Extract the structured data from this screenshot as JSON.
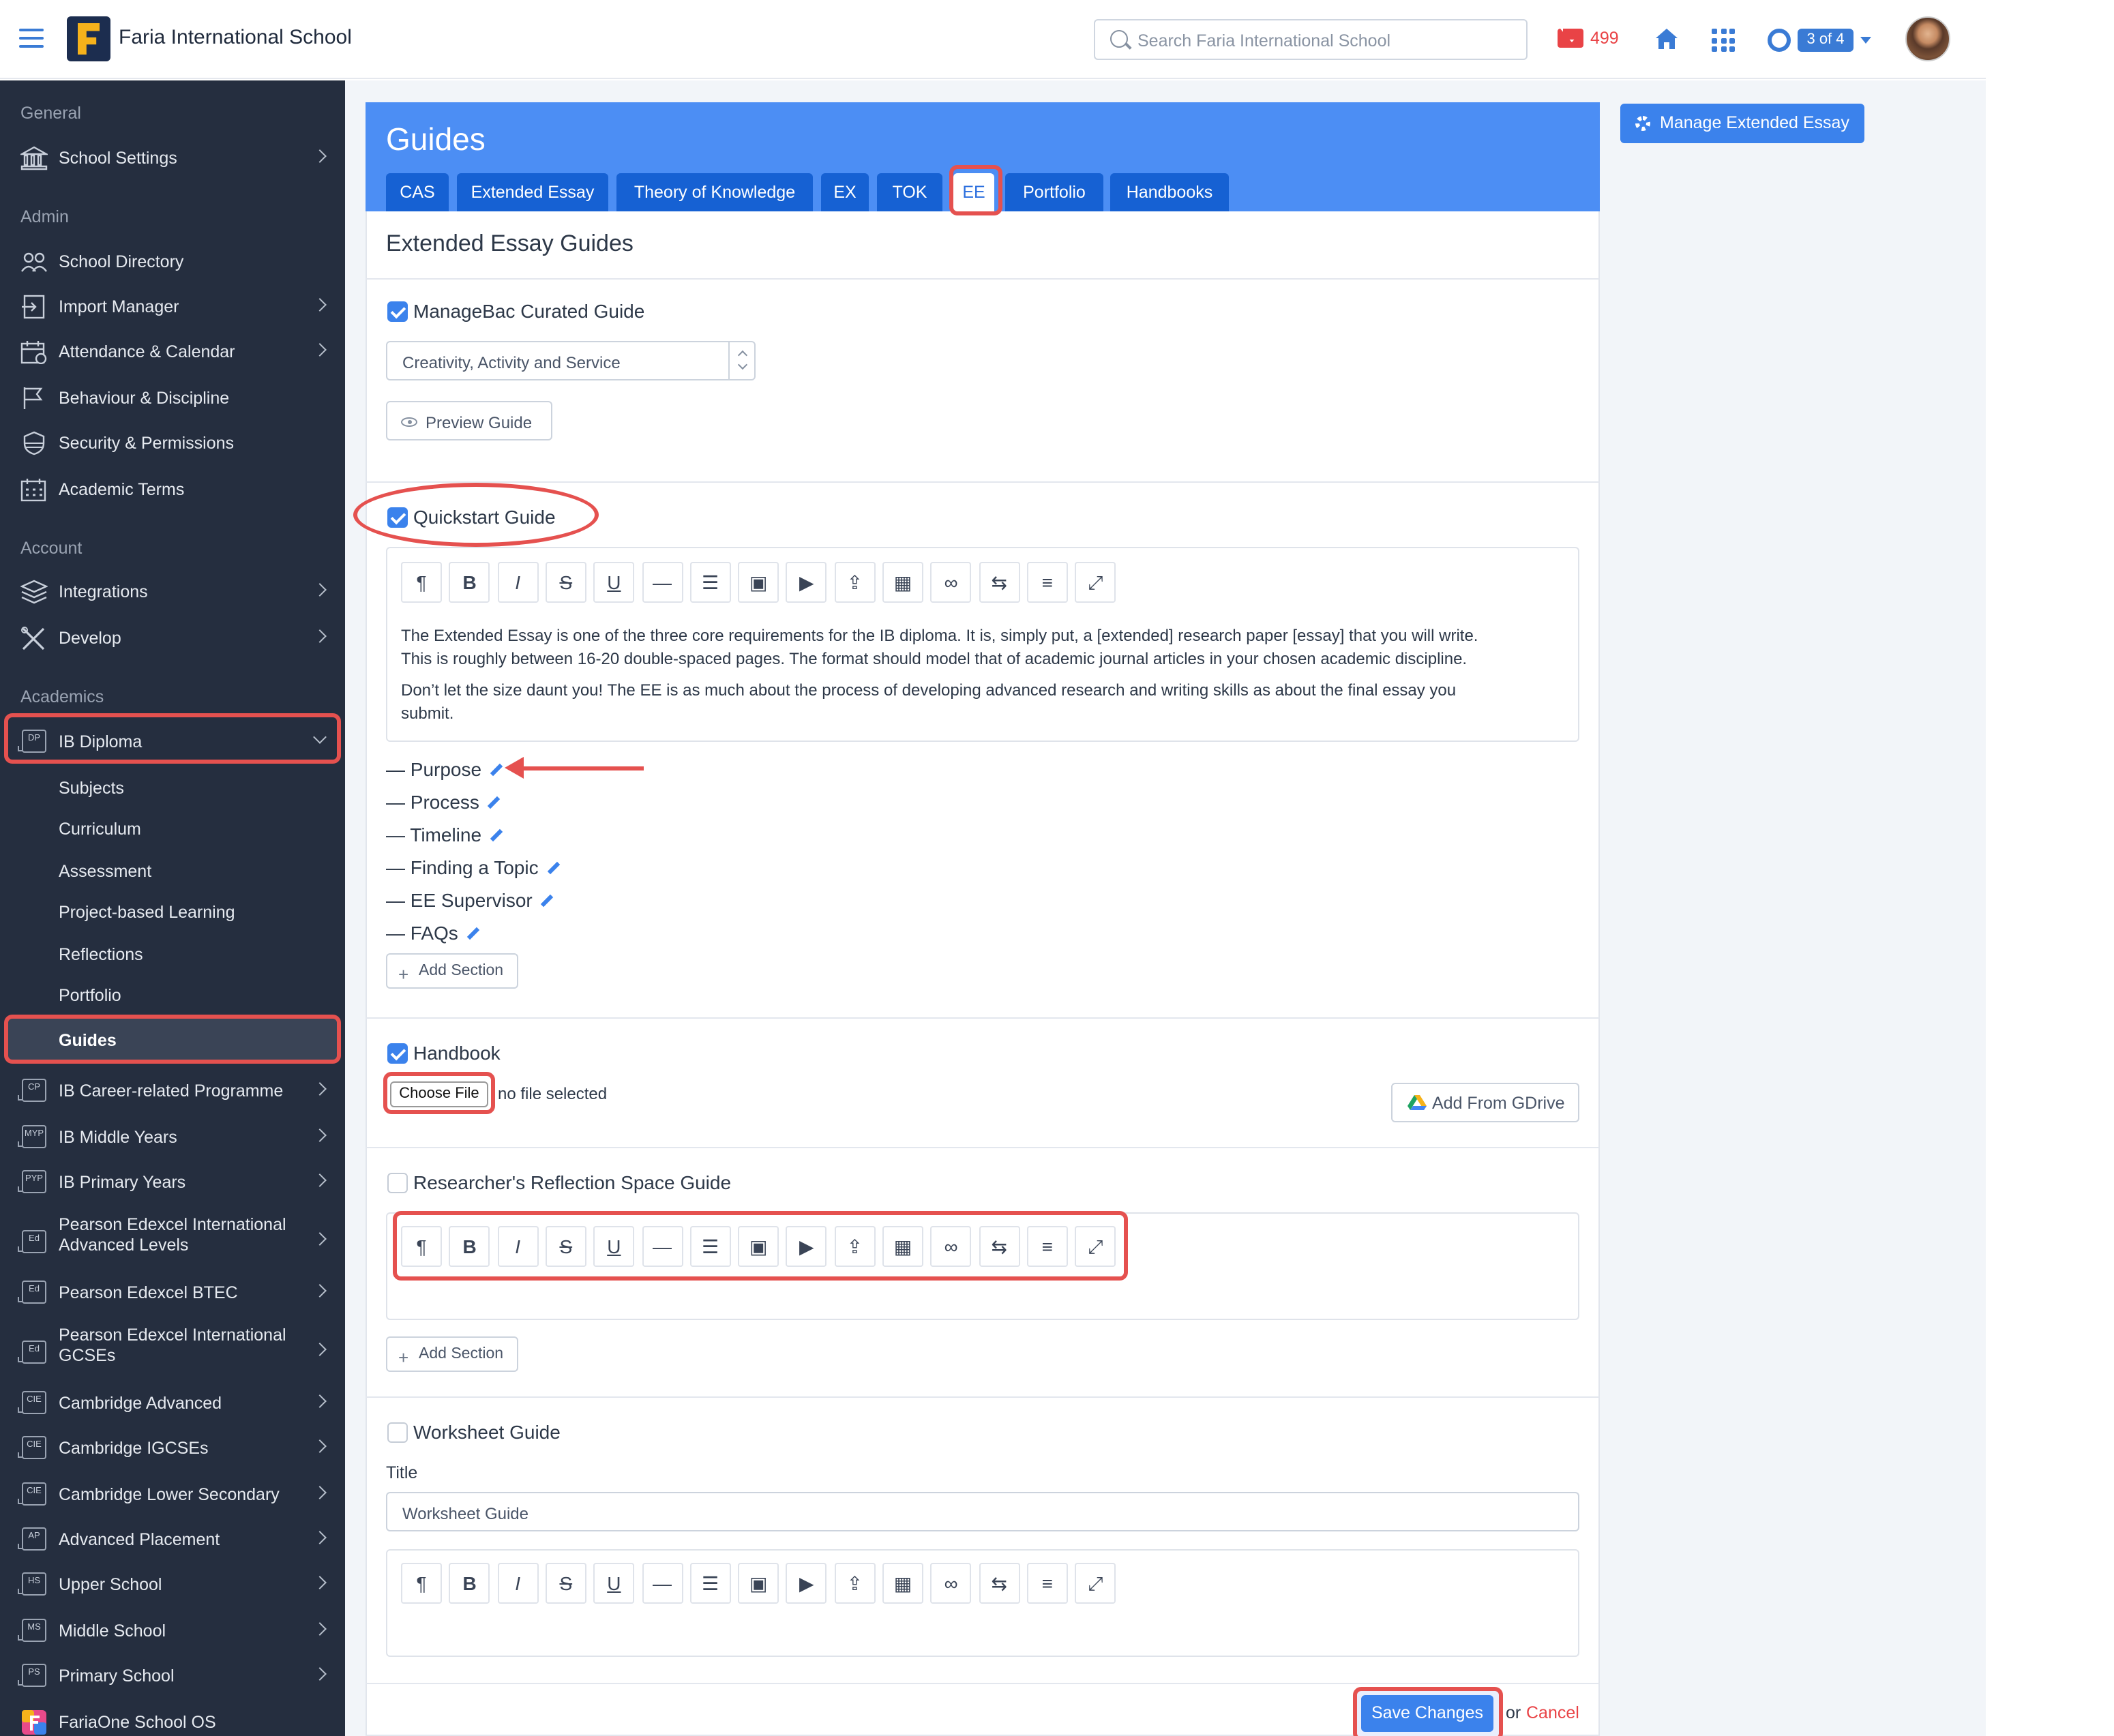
{
  "header": {
    "school_name": "Faria International School",
    "search_placeholder": "Search Faria International School",
    "mail_count": "499",
    "page_indicator": "3 of 4"
  },
  "sidebar": {
    "sections": {
      "general": "General",
      "admin": "Admin",
      "account": "Account",
      "academics": "Academics"
    },
    "general_items": [
      {
        "label": "School Settings",
        "icon": "bank-icon"
      }
    ],
    "admin_items": [
      {
        "label": "School Directory",
        "icon": "users-icon"
      },
      {
        "label": "Import Manager",
        "icon": "import-icon"
      },
      {
        "label": "Attendance & Calendar",
        "icon": "calendar-icon"
      },
      {
        "label": "Behaviour & Discipline",
        "icon": "flag-icon"
      },
      {
        "label": "Security & Permissions",
        "icon": "shield-icon"
      },
      {
        "label": "Academic Terms",
        "icon": "calendar-grid-icon"
      }
    ],
    "account_items": [
      {
        "label": "Integrations",
        "icon": "layers-icon"
      },
      {
        "label": "Develop",
        "icon": "tools-icon"
      }
    ],
    "ib_diploma": {
      "badge": "DP",
      "label": "IB Diploma"
    },
    "ib_sub": [
      "Subjects",
      "Curriculum",
      "Assessment",
      "Project-based Learning",
      "Reflections",
      "Portfolio",
      "Guides"
    ],
    "programmes": [
      {
        "badge": "CP",
        "label": "IB Career-related Programme"
      },
      {
        "badge": "MYP",
        "label": "IB Middle Years"
      },
      {
        "badge": "PYP",
        "label": "IB Primary Years"
      },
      {
        "badge": "Ed",
        "label": "Pearson Edexcel International",
        "label2": "Advanced Levels"
      },
      {
        "badge": "Ed",
        "label": "Pearson Edexcel BTEC"
      },
      {
        "badge": "Ed",
        "label": "Pearson Edexcel International",
        "label2": "GCSEs"
      },
      {
        "badge": "CIE",
        "label": "Cambridge Advanced"
      },
      {
        "badge": "CIE",
        "label": "Cambridge IGCSEs"
      },
      {
        "badge": "CIE",
        "label": "Cambridge Lower Secondary"
      },
      {
        "badge": "AP",
        "label": "Advanced Placement"
      },
      {
        "badge": "HS",
        "label": "Upper School"
      },
      {
        "badge": "MS",
        "label": "Middle School"
      },
      {
        "badge": "PS",
        "label": "Primary School"
      }
    ],
    "fariaone": "FariaOne School OS"
  },
  "main": {
    "title": "Guides",
    "tabs": [
      "CAS",
      "Extended Essay",
      "Theory of Knowledge",
      "EX",
      "TOK",
      "EE",
      "Portfolio",
      "Handbooks"
    ],
    "active_tab": "EE",
    "manage_button": "Manage Extended Essay",
    "section_title": "Extended Essay Guides",
    "curated": {
      "label": "ManageBac Curated Guide",
      "checked": true,
      "select_value": "Creativity, Activity and Service",
      "preview_button": "Preview Guide"
    },
    "quickstart": {
      "label": "Quickstart Guide",
      "checked": true,
      "para1_line1": "The Extended Essay is one of the three core requirements for the IB diploma. It is, simply put, a [extended] research paper [essay] that you will write.",
      "para1_line2": "This is roughly between 16-20 double-spaced pages. The format should model that of academic journal articles in your chosen academic discipline.",
      "para2_line1": "Don’t let the size daunt you! The EE is as much about the process of developing advanced research and writing skills as about the final essay you",
      "para2_line2": "submit.",
      "sections": [
        "— Purpose",
        "— Process",
        "— Timeline",
        "— Finding a Topic",
        "— EE Supervisor",
        "— FAQs"
      ],
      "add_section": "Add Section"
    },
    "handbook": {
      "label": "Handbook",
      "checked": true,
      "choose_file": "Choose File",
      "no_file": "no file selected",
      "gdrive_button": "Add From GDrive"
    },
    "researcher": {
      "label": "Researcher's Reflection Space Guide",
      "checked": false,
      "add_section": "Add Section"
    },
    "worksheet": {
      "label": "Worksheet Guide",
      "checked": false,
      "title_label": "Title",
      "title_value": "Worksheet Guide"
    },
    "toolbar_icons": [
      "paragraph-icon",
      "bold-icon",
      "italic-icon",
      "strikethrough-icon",
      "underline-icon",
      "horizontal-rule-icon",
      "list-icon",
      "image-icon",
      "video-icon",
      "upload-icon",
      "table-icon",
      "link-icon",
      "swap-icon",
      "align-icon",
      "expand-icon"
    ],
    "toolbar_glyphs": [
      "¶",
      "B",
      "I",
      "S",
      "U",
      "—",
      "☰",
      "▣",
      "▶",
      "⇪",
      "▦",
      "∞",
      "⇆",
      "≡",
      "⤢"
    ],
    "footer": {
      "save": "Save Changes",
      "or": "or",
      "cancel": "Cancel"
    }
  },
  "colors": {
    "sidebar_bg": "#252e3f",
    "hero_blue": "#4c8ef4",
    "tab_blue": "#1661d3",
    "accent": "#3b82ec",
    "highlight_red": "#e5514f"
  }
}
